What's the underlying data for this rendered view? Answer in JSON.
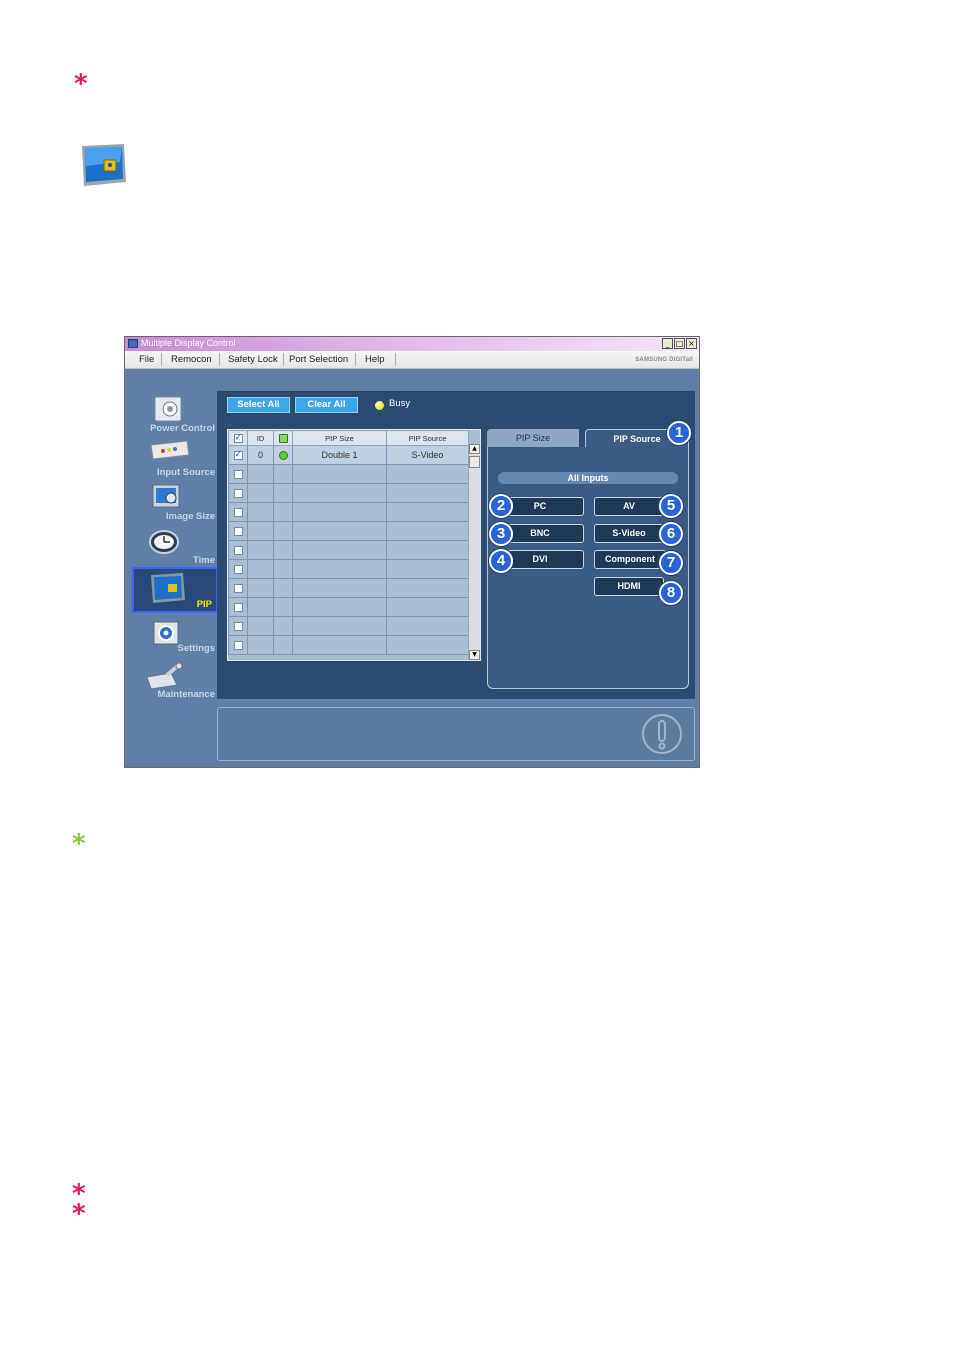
{
  "window": {
    "title": "Multiple Display Control",
    "min": "_",
    "max": "□",
    "close": "×",
    "brand": "SAMSUNG DIGITall"
  },
  "menu": [
    "File",
    "Remocon",
    "Safety Lock",
    "Port Selection",
    "Help"
  ],
  "sidebar": [
    {
      "label": "Power Control",
      "icon": "power-control-icon"
    },
    {
      "label": "Input Source",
      "icon": "input-source-icon"
    },
    {
      "label": "Image Size",
      "icon": "image-size-icon"
    },
    {
      "label": "Time",
      "icon": "clock-icon"
    },
    {
      "label": "PIP",
      "icon": "pip-icon",
      "active": true
    },
    {
      "label": "Settings",
      "icon": "settings-icon"
    },
    {
      "label": "Maintenance",
      "icon": "maintenance-icon"
    }
  ],
  "toolbar": {
    "select_all": "Select All",
    "clear_all": "Clear All",
    "busy": "Busy"
  },
  "grid": {
    "headers": [
      "ID",
      "PIP Size",
      "PIP Source"
    ],
    "row": {
      "id": "0",
      "size": "Double 1",
      "source": "S-Video"
    }
  },
  "tabs": {
    "pip_size": "PIP Size",
    "pip_source": "PIP Source"
  },
  "sources": {
    "all_inputs": "All Inputs",
    "pc": "PC",
    "bnc": "BNC",
    "dvi": "DVI",
    "av": "AV",
    "svideo": "S-Video",
    "component": "Component",
    "hdmi": "HDMI"
  },
  "callouts": [
    "1",
    "2",
    "3",
    "4",
    "5",
    "6",
    "7",
    "8"
  ],
  "colors": {
    "asterisk_red": "#e8185c",
    "asterisk_green": "#8cc63f",
    "panel": "#2d4b70",
    "accent": "#3aa8e8"
  }
}
